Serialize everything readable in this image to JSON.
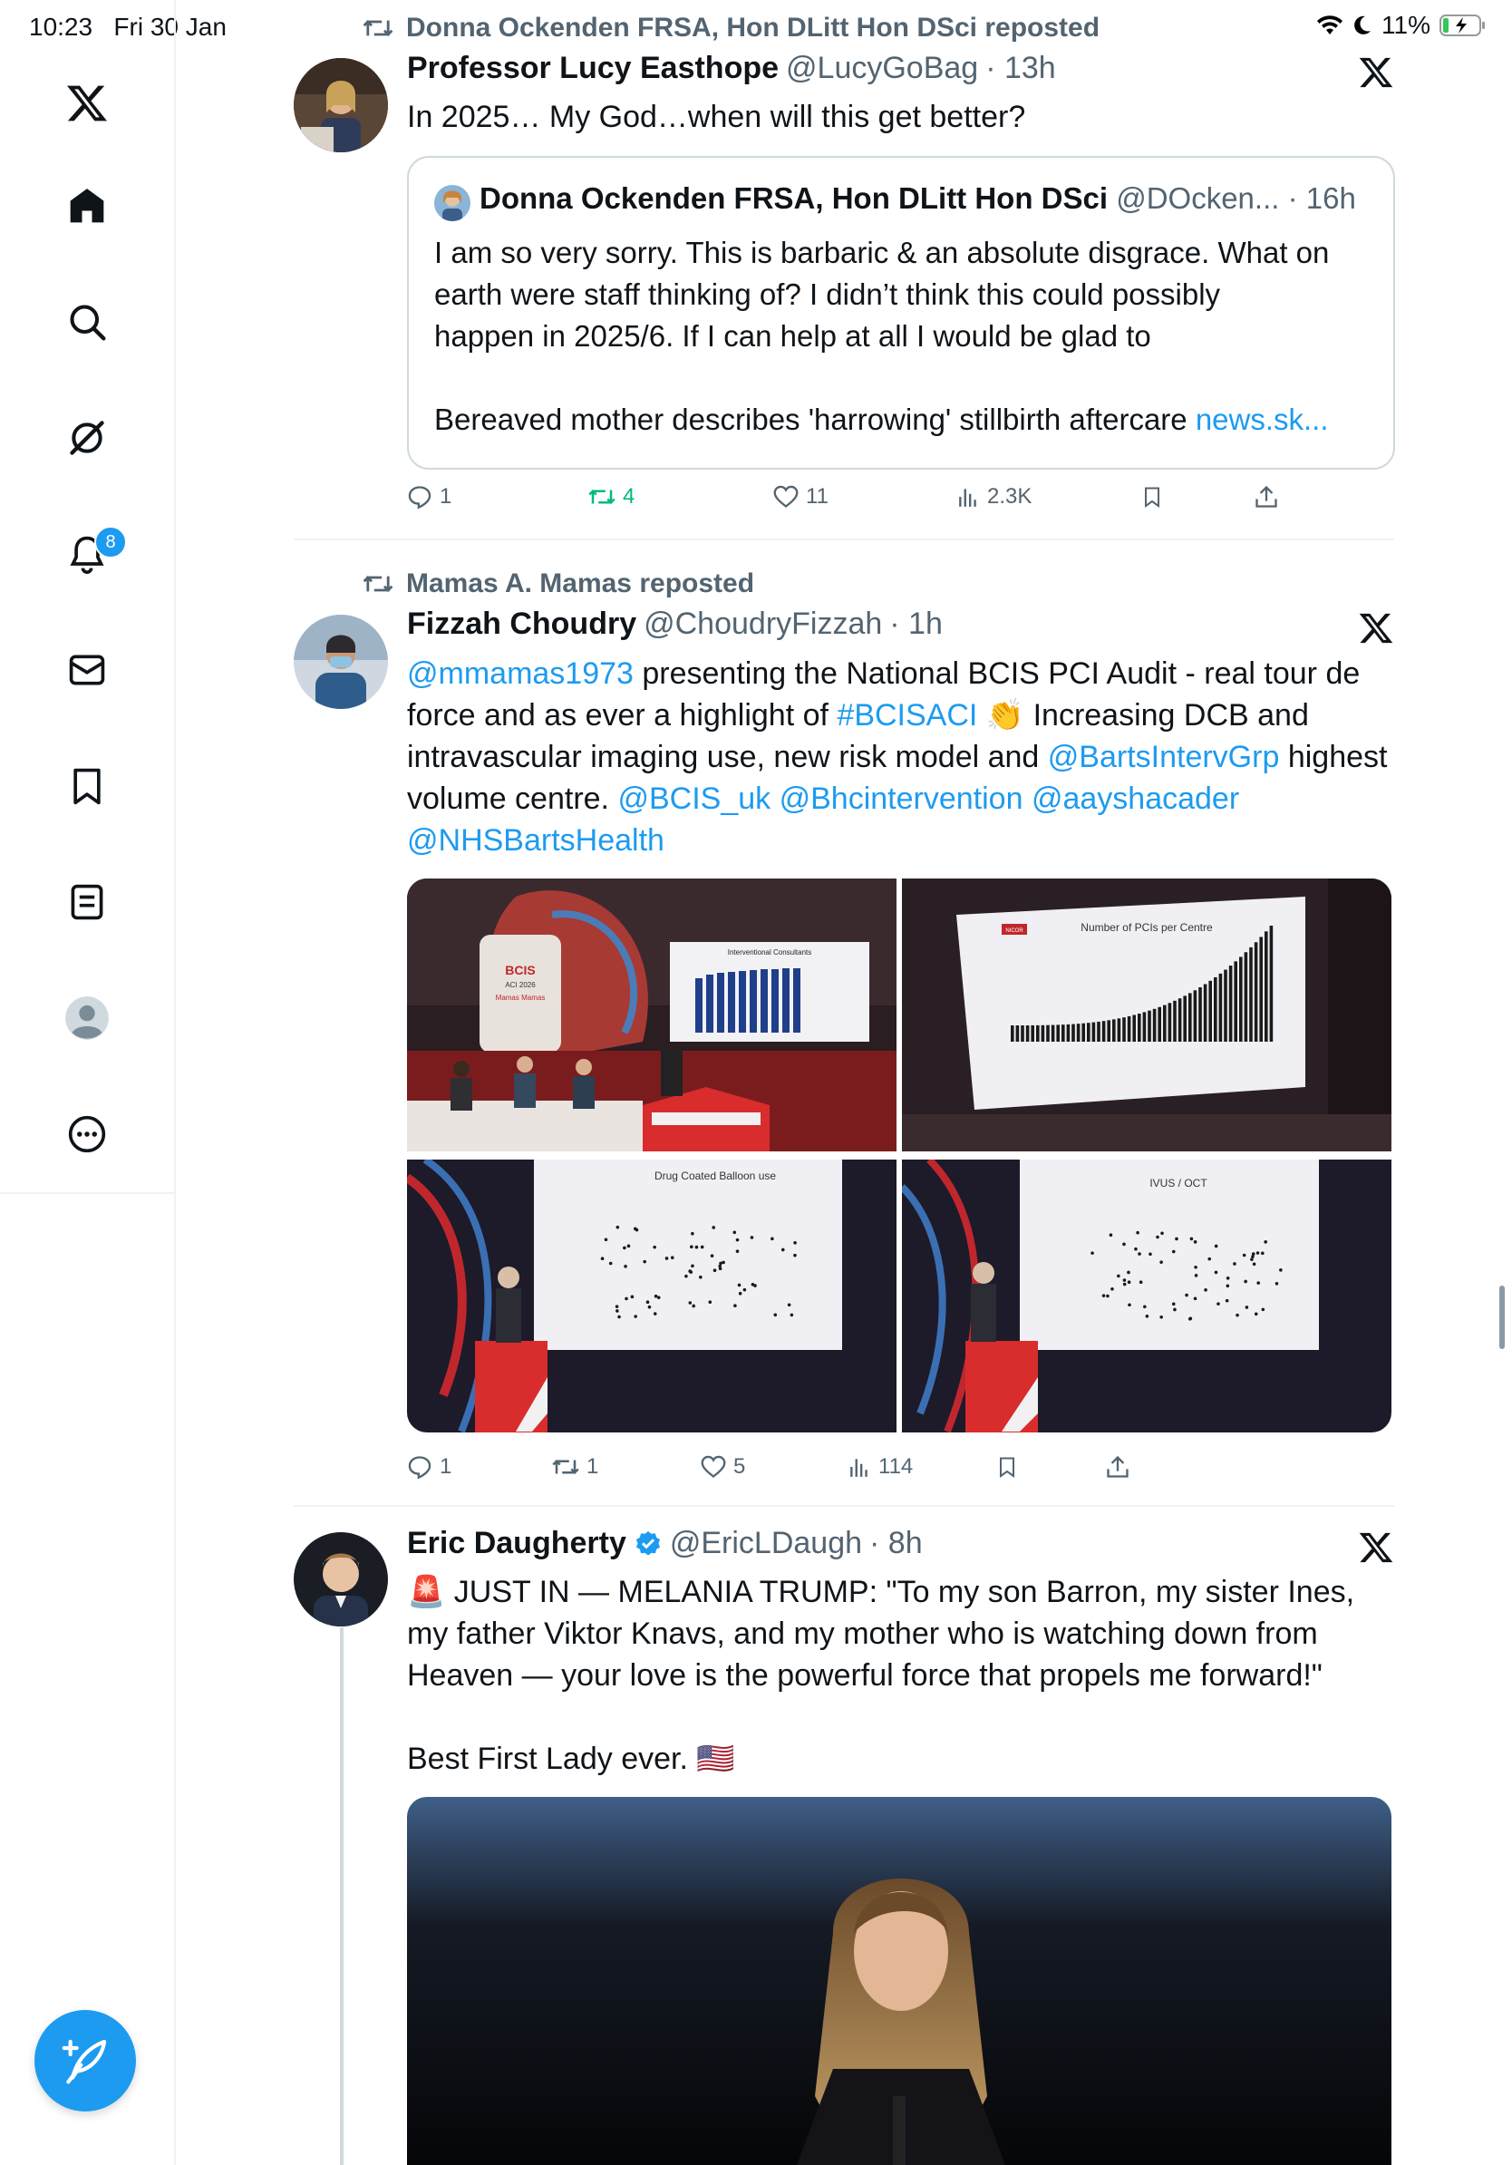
{
  "status_bar": {
    "time": "10:23",
    "date": "Fri 30 Jan",
    "battery": "11%"
  },
  "sidebar": {
    "items": [
      {
        "name": "x-logo-icon"
      },
      {
        "name": "home-icon"
      },
      {
        "name": "search-icon"
      },
      {
        "name": "grok-icon"
      },
      {
        "name": "notifications-icon",
        "badge": "8"
      },
      {
        "name": "messages-icon"
      },
      {
        "name": "bookmarks-icon"
      },
      {
        "name": "lists-icon"
      },
      {
        "name": "profile-icon"
      },
      {
        "name": "more-icon"
      }
    ],
    "compose_icon": "compose-post-icon"
  },
  "tweets": [
    {
      "reposted_by": "Donna Ockenden FRSA, Hon DLitt Hon DSci reposted",
      "author": "Professor Lucy Easthope",
      "handle": "@LucyGoBag",
      "time": "· 13h",
      "text": "In 2025… My God…when will this get better?",
      "quote": {
        "author": "Donna Ockenden FRSA, Hon DLitt Hon DSci",
        "handle_time": "@DOcken... · 16h",
        "line1": "I am so very sorry. This is barbaric & an absolute disgrace. What on",
        "line2": "earth were staff thinking of? I didn’t think this could possibly",
        "line3": "happen in 2025/6. If I can help at all I would be glad to",
        "line4": "Bereaved mother describes 'harrowing' stillbirth aftercare ",
        "link": "news.sk..."
      },
      "replies": "1",
      "reposts": "4",
      "likes": "11",
      "views": "2.3K"
    },
    {
      "reposted_by": "Mamas A. Mamas reposted",
      "author": "Fizzah Choudry",
      "handle": "@ChoudryFizzah",
      "time": "· 1h",
      "text": {
        "m1": "@mmamas1973",
        "t1": " presenting the National BCIS PCI Audit - real tour de force and as ever a highlight of ",
        "m2": "#BCISACI",
        "t2": " 👏 Increasing DCB and intravascular imaging use, new risk model and ",
        "m3": "@BartsIntervGrp",
        "t3": " highest volume centre. ",
        "m4": "@BCIS_uk",
        "m5": "@Bhcintervention",
        "m6": "@aayshacader",
        "m7": "@NHSBartsHealth"
      },
      "images": {
        "img1_logo": "BCIS",
        "img1_sub": "ACI 2026",
        "img1_name": "Mamas Mamas",
        "img1_slide": "Interventional Consultants",
        "img2_logo": "NICOR",
        "img2_title": "Number of PCIs per Centre",
        "img3_title": "Drug Coated Balloon use",
        "img4_title": "IVUS / OCT"
      },
      "replies": "1",
      "reposts": "1",
      "likes": "5",
      "views": "114"
    },
    {
      "author": "Eric Daugherty",
      "handle": "@EricLDaugh",
      "time": "· 8h",
      "text_line1": "🚨 JUST IN — MELANIA TRUMP: \"To my son Barron, my sister Ines, my father Viktor Knavs, and my mother who is watching down from Heaven — your love is the powerful force that propels me forward!\"",
      "text_line2": "Best First Lady ever. 🇺🇸"
    }
  ],
  "colors": {
    "accent": "#1d9bf0",
    "repost_green": "#00ba7c",
    "text": "#0f1419",
    "secondary": "#536471"
  }
}
